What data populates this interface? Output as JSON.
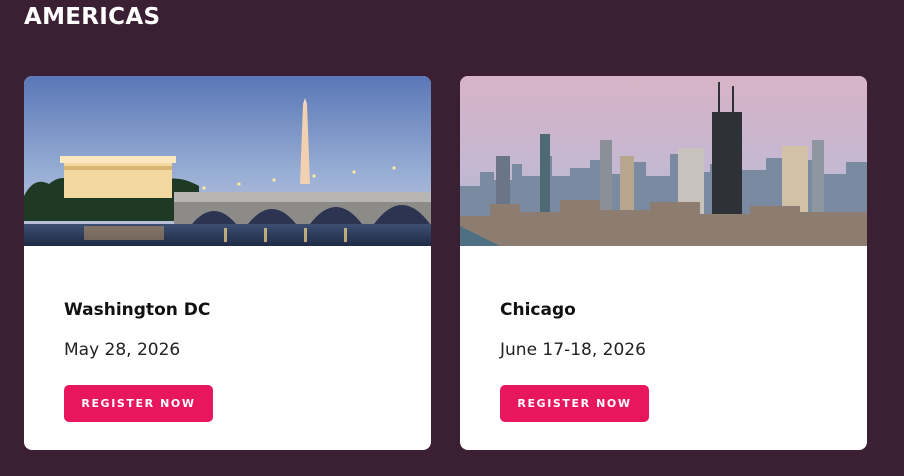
{
  "section": {
    "title": "AMERICAS"
  },
  "events": [
    {
      "city": "Washington DC",
      "date": "May 28, 2026",
      "cta": "REGISTER NOW"
    },
    {
      "city": "Chicago",
      "date": "June 17-18, 2026",
      "cta": "REGISTER NOW"
    }
  ],
  "colors": {
    "background": "#3b1f33",
    "card": "#ffffff",
    "cta": "#e8175d"
  }
}
